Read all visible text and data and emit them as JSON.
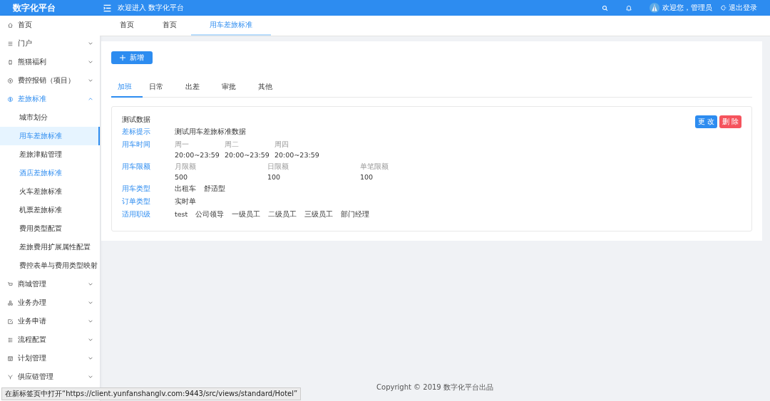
{
  "header": {
    "logo": "数字化平台",
    "welcome": "欢迎进入 数字化平台",
    "greeting": "欢迎您，管理员",
    "logout": "退出登录"
  },
  "sidebar": {
    "items": [
      {
        "label": "首页",
        "active": false
      },
      {
        "label": "门户",
        "active": false,
        "expanded": false
      },
      {
        "label": "熊猫福利",
        "active": false,
        "expanded": false
      },
      {
        "label": "费控报销（项目）",
        "active": false,
        "expanded": false
      },
      {
        "label": "差旅标准",
        "active": true,
        "expanded": true,
        "children": [
          {
            "label": "城市划分",
            "selected": false,
            "hovered": false
          },
          {
            "label": "用车差旅标准",
            "selected": true,
            "hovered": false
          },
          {
            "label": "差旅津贴管理",
            "selected": false,
            "hovered": false
          },
          {
            "label": "酒店差旅标准",
            "selected": false,
            "hovered": true
          },
          {
            "label": "火车差旅标准",
            "selected": false,
            "hovered": false
          },
          {
            "label": "机票差旅标准",
            "selected": false,
            "hovered": false
          },
          {
            "label": "费用类型配置",
            "selected": false,
            "hovered": false
          },
          {
            "label": "差旅费用扩展属性配置",
            "selected": false,
            "hovered": false
          },
          {
            "label": "费控表单与费用类型映射",
            "selected": false,
            "hovered": false
          }
        ]
      },
      {
        "label": "商城管理",
        "active": false,
        "expanded": false
      },
      {
        "label": "业务办理",
        "active": false,
        "expanded": false
      },
      {
        "label": "业务申请",
        "active": false,
        "expanded": false
      },
      {
        "label": "流程配置",
        "active": false,
        "expanded": false
      },
      {
        "label": "计划管理",
        "active": false,
        "expanded": false
      },
      {
        "label": "供应链管理",
        "active": false,
        "expanded": false
      }
    ]
  },
  "page_tabs": [
    {
      "label": "首页",
      "selected": false
    },
    {
      "label": "首页",
      "selected": false
    },
    {
      "label": "用车差旅标准",
      "selected": true
    }
  ],
  "add_button": "新增",
  "tabs": [
    {
      "label": "加班",
      "selected": true
    },
    {
      "label": "日常",
      "selected": false
    },
    {
      "label": "出差",
      "selected": false
    },
    {
      "label": "审批",
      "selected": false
    },
    {
      "label": "其他",
      "selected": false
    }
  ],
  "card": {
    "title": "测试数据",
    "edit_button": "更 改",
    "delete_button": "删 除",
    "fields": [
      {
        "label": "差标提示",
        "kind": "text",
        "value": "测试用车差旅标准数据"
      },
      {
        "label": "用车时间",
        "kind": "times",
        "columns": [
          {
            "caption": "周一",
            "value": "20:00~23:59"
          },
          {
            "caption": "周二",
            "value": "20:00~23:59"
          },
          {
            "caption": "周四",
            "value": "20:00~23:59"
          }
        ]
      },
      {
        "label": "用车限额",
        "kind": "limits",
        "columns": [
          {
            "caption": "月限额",
            "value": "500"
          },
          {
            "caption": "日限额",
            "value": "100"
          },
          {
            "caption": "单笔限额",
            "value": "100"
          }
        ]
      },
      {
        "label": "用车类型",
        "kind": "tags",
        "values": [
          "出租车",
          "舒适型"
        ]
      },
      {
        "label": "订单类型",
        "kind": "tags",
        "values": [
          "实时单"
        ]
      },
      {
        "label": "适用职级",
        "kind": "tags",
        "values": [
          "test",
          "公司领导",
          "一级员工",
          "二级员工",
          "三级员工",
          "部门经理"
        ]
      }
    ]
  },
  "footer": "Copyright © 2019 数字化平台出品",
  "link_preview": "在新标签页中打开“https://client.yunfanshanglv.com:9443/src/views/standard/Hotel”"
}
